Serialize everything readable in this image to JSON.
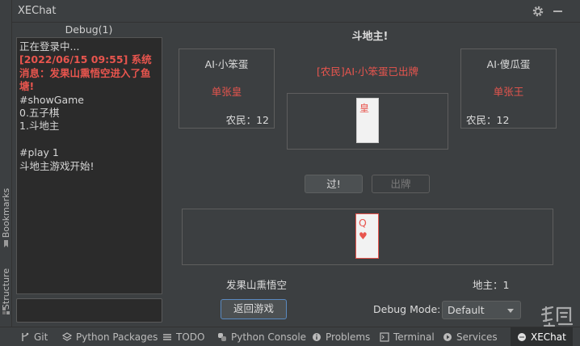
{
  "titlebar": {
    "title": "XEChat"
  },
  "left_strip": {
    "bookmarks": "Bookmarks",
    "structure": "Structure"
  },
  "debug": {
    "title": "Debug(1)",
    "log": [
      {
        "text": "正在登录中...",
        "type": "normal"
      },
      {
        "text": "[2022/06/15 09:55] 系统消息：发果山熏悟空进入了鱼塘!",
        "type": "system"
      },
      {
        "text": "#showGame",
        "type": "normal"
      },
      {
        "text": "0.五子棋",
        "type": "normal"
      },
      {
        "text": "1.斗地主",
        "type": "normal"
      },
      {
        "text": " ",
        "type": "normal"
      },
      {
        "text": "#play 1",
        "type": "normal"
      },
      {
        "text": "斗地主游戏开始!",
        "type": "normal"
      }
    ]
  },
  "game": {
    "title": "斗地主!",
    "left_player": {
      "name": "AI·小笨蛋",
      "last_play": "单张皇",
      "count": "农民：12"
    },
    "right_player": {
      "name": "AI·傻瓜蛋",
      "last_play": "单张王",
      "count": "农民：12"
    },
    "announcement": "[农民]AI·小笨蛋已出牌",
    "center_card": {
      "rank": "皇"
    },
    "pass_button": "过!",
    "play_button": "出牌",
    "hand_cards": [
      {
        "rank": "Q",
        "suit": "♥"
      }
    ],
    "self_name": "发果山熏悟空",
    "self_role": "地主：1",
    "back_button": "返回游戏",
    "debug_mode_label": "Debug Mode:",
    "debug_mode_value": "Default"
  },
  "bottom_bar": {
    "items": [
      {
        "label": "Git",
        "icon": "branch-icon"
      },
      {
        "label": "Python Packages",
        "icon": "layers-icon"
      },
      {
        "label": "TODO",
        "icon": "list-icon"
      },
      {
        "label": "Python Console",
        "icon": "python-icon"
      },
      {
        "label": "Problems",
        "icon": "info-icon"
      },
      {
        "label": "Terminal",
        "icon": "terminal-icon"
      },
      {
        "label": "Services",
        "icon": "play-icon"
      },
      {
        "label": "XEChat",
        "icon": "chat-icon"
      }
    ]
  },
  "colors": {
    "accent_red": "#e8554e",
    "background": "#3c3f41",
    "log_background": "#2b2b2b"
  }
}
